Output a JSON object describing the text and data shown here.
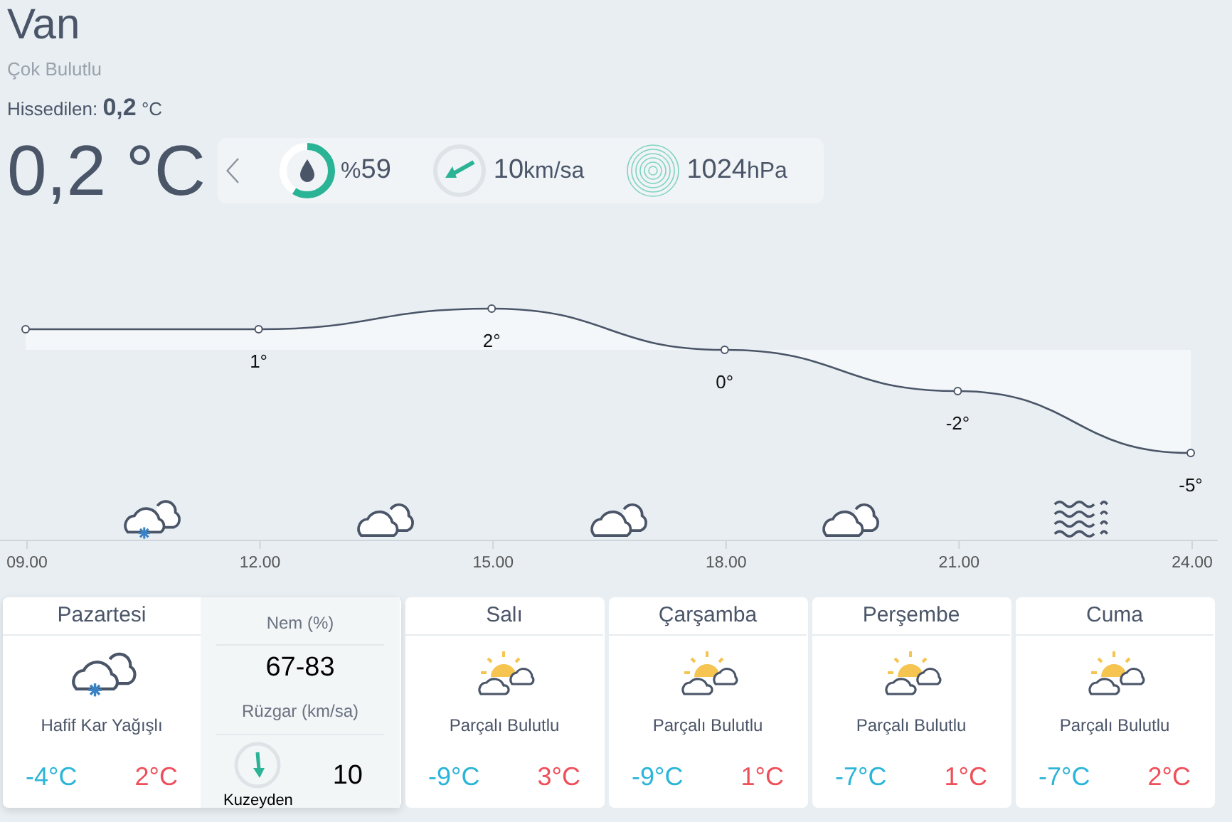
{
  "city": "Van",
  "condition": "Çok Bulutlu",
  "feels_like": {
    "label": "Hissedilen:",
    "value": "0,2",
    "unit": "°C"
  },
  "temperature": "0,2 °C",
  "metrics": [
    {
      "kind": "humidity",
      "unit": "%",
      "value": "59"
    },
    {
      "kind": "wind",
      "value": "10",
      "unit": "km/sa"
    },
    {
      "kind": "pressure",
      "value": "1024",
      "unit": "hPa"
    }
  ],
  "hourly": {
    "icons": [
      {
        "kind": "snow"
      },
      {
        "kind": "cloudy"
      },
      {
        "kind": "cloudy"
      },
      {
        "kind": "cloudy"
      },
      {
        "kind": "fog"
      }
    ],
    "chart_data": {
      "type": "line",
      "categories": [
        "09.00",
        "12.00",
        "15.00",
        "18.00",
        "21.00",
        "24.00"
      ],
      "series": [
        {
          "color": "#4a5568",
          "marker": "circle",
          "values": [
            1,
            1,
            2,
            0,
            -2,
            -5
          ],
          "value_labels": [
            null,
            "1°",
            "2°",
            "0°",
            "-2°",
            "-5°"
          ]
        }
      ]
    }
  },
  "days": [
    {
      "name": "Pazartesi",
      "kind": "snow",
      "condition": "Hafif Kar Yağışlı",
      "low": "-4°C",
      "high": "2°C",
      "selected": true
    },
    {
      "name": "Salı",
      "kind": "partly",
      "condition": "Parçalı Bulutlu",
      "low": "-9°C",
      "high": "3°C",
      "selected": false
    },
    {
      "name": "Çarşamba",
      "kind": "partly",
      "condition": "Parçalı Bulutlu",
      "low": "-9°C",
      "high": "1°C",
      "selected": false
    },
    {
      "name": "Perşembe",
      "kind": "partly",
      "condition": "Parçalı Bulutlu",
      "low": "-7°C",
      "high": "1°C",
      "selected": false
    },
    {
      "name": "Cuma",
      "kind": "partly",
      "condition": "Parçalı Bulutlu",
      "low": "-7°C",
      "high": "2°C",
      "selected": false
    }
  ],
  "details": {
    "humidity_label": "Nem (%)",
    "humidity": "67-83",
    "wind_label": "Rüzgar (km/sa)",
    "wind_direction": "Kuzeyden",
    "wind_speed": "10"
  }
}
